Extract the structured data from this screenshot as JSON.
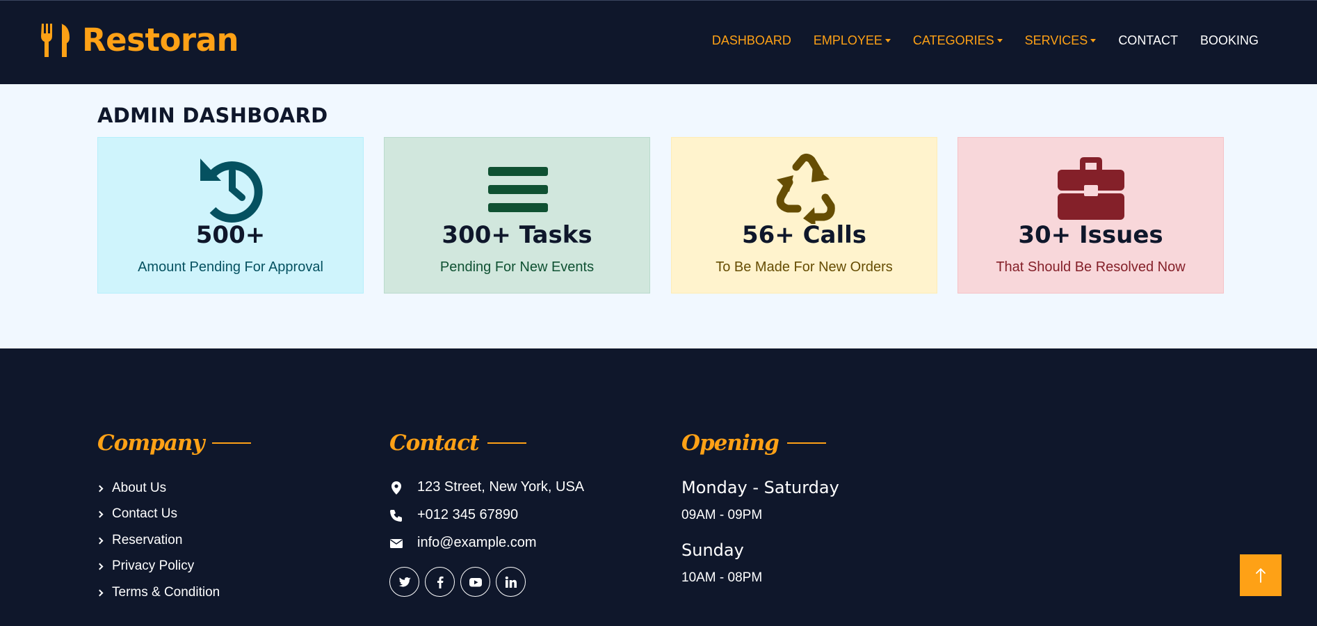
{
  "brand": {
    "name": "Restoran",
    "icon": "utensils-icon"
  },
  "nav": {
    "dashboard": "DASHBOARD",
    "employee": "EMPLOYEE",
    "categories": "CATEGORIES",
    "services": "SERVICES",
    "contact": "CONTACT",
    "booking": "BOOKING"
  },
  "main": {
    "title": "ADMIN DASHBOARD",
    "cards": [
      {
        "icon": "history-icon",
        "value": "500+",
        "label": "Amount Pending For Approval",
        "bg": "#cff4fc",
        "icon_color": "#055160"
      },
      {
        "icon": "bars-icon",
        "value": "300+ Tasks",
        "label": "Pending For New Events",
        "bg": "#d1e7dd",
        "icon_color": "#0f5132"
      },
      {
        "icon": "recycle-icon",
        "value": "56+ Calls",
        "label": "To Be Made For New Orders",
        "bg": "#fff3cd",
        "icon_color": "#664d03"
      },
      {
        "icon": "briefcase-icon",
        "value": "30+ Issues",
        "label": "That Should Be Resolved Now",
        "bg": "#f8d7da",
        "icon_color": "#842029"
      }
    ]
  },
  "footer": {
    "company": {
      "title": "Company",
      "links": [
        "About Us",
        "Contact Us",
        "Reservation",
        "Privacy Policy",
        "Terms & Condition"
      ]
    },
    "contact": {
      "title": "Contact",
      "address": "123 Street, New York, USA",
      "phone": "+012 345 67890",
      "email": "info@example.com",
      "socials": [
        "twitter-icon",
        "facebook-icon",
        "youtube-icon",
        "linkedin-icon"
      ]
    },
    "opening": {
      "title": "Opening",
      "day1": "Monday - Saturday",
      "hours1": "09AM - 09PM",
      "day2": "Sunday",
      "hours2": "10AM - 08PM"
    }
  },
  "colors": {
    "primary": "#fea116",
    "dark": "#0f172b",
    "light_bg": "#f1f8ff"
  }
}
